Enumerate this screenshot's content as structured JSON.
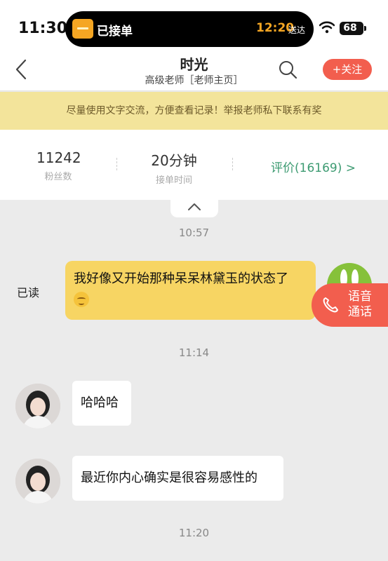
{
  "status_bar": {
    "time": "11:30",
    "island_label": "已接单",
    "island_time": "12:20",
    "island_suffix": "送达",
    "battery": "68"
  },
  "header": {
    "title": "时光",
    "subtitle": "高级老师［老师主页］",
    "follow_label": "+关注"
  },
  "notice": "尽量使用文字交流，方便查看记录！举报老师私下联系有奖",
  "stats": {
    "fans_value": "11242",
    "fans_label": "粉丝数",
    "time_value": "20分钟",
    "time_label": "接单时间",
    "rating_link": "评价(16169) >"
  },
  "chat": {
    "timestamps": [
      "10:57",
      "11:14",
      "11:20"
    ],
    "read_status": "已读",
    "messages": [
      {
        "from": "me",
        "text": "我好像又开始那种呆呆林黛玉的状态了"
      },
      {
        "from": "teacher",
        "text": "哈哈哈"
      },
      {
        "from": "teacher",
        "text": "最近你内心确实是很容易感性的"
      }
    ]
  },
  "voice_call": {
    "line1": "语音",
    "line2": "通话"
  },
  "colors": {
    "accent": "#f25e4e",
    "my_bubble": "#f7d563",
    "notice_bg": "#f3e49b",
    "rating": "#3d9b72"
  },
  "icons": [
    "back-icon",
    "search-icon",
    "wifi-icon",
    "phone-icon",
    "chevron-up-icon"
  ]
}
